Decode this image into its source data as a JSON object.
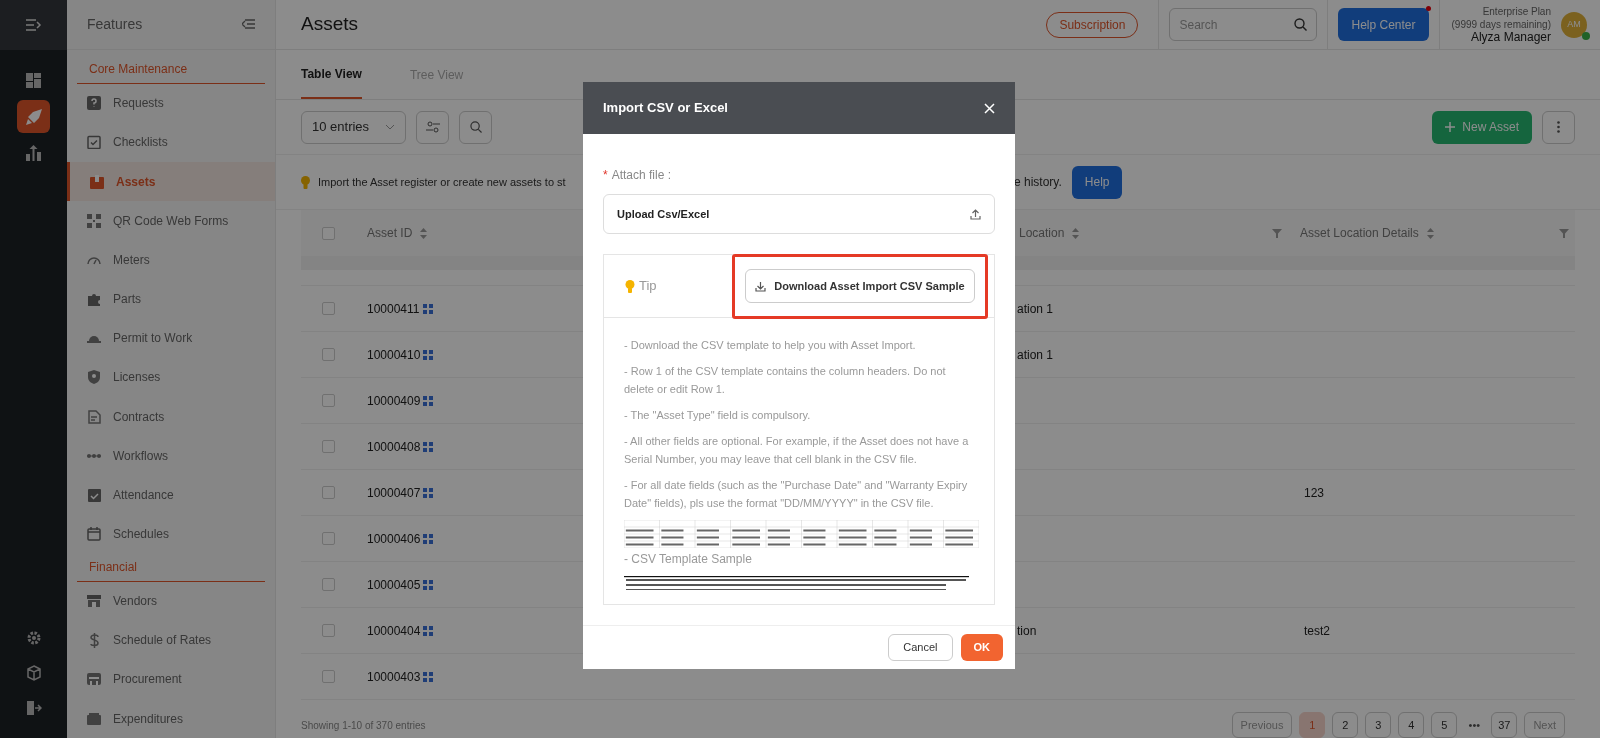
{
  "sidebar": {
    "title": "Features",
    "sections": [
      {
        "heading": "Core Maintenance",
        "items": [
          {
            "label": "Requests",
            "selected": false
          },
          {
            "label": "Checklists",
            "selected": false
          },
          {
            "label": "Assets",
            "selected": true
          },
          {
            "label": "QR Code Web Forms",
            "selected": false
          },
          {
            "label": "Meters",
            "selected": false
          },
          {
            "label": "Parts",
            "selected": false
          },
          {
            "label": "Permit to Work",
            "selected": false
          },
          {
            "label": "Licenses",
            "selected": false
          },
          {
            "label": "Contracts",
            "selected": false
          },
          {
            "label": "Workflows",
            "selected": false
          },
          {
            "label": "Attendance",
            "selected": false
          },
          {
            "label": "Schedules",
            "selected": false
          }
        ]
      },
      {
        "heading": "Financial",
        "items": [
          {
            "label": "Vendors",
            "selected": false
          },
          {
            "label": "Schedule of Rates",
            "selected": false
          },
          {
            "label": "Procurement",
            "selected": false
          },
          {
            "label": "Expenditures",
            "selected": false
          }
        ]
      }
    ]
  },
  "header": {
    "title": "Assets",
    "subscription": "Subscription",
    "search_placeholder": "Search",
    "help_center": "Help Center",
    "plan": "Enterprise Plan",
    "days": "(9999 days remaining)",
    "user": "Alyza Manager",
    "avatar": "AM"
  },
  "tabs": [
    {
      "label": "Table View",
      "selected": true
    },
    {
      "label": "Tree View",
      "selected": false
    }
  ],
  "toolbar": {
    "entries": "10 entries",
    "new_asset": "New Asset"
  },
  "info": {
    "text_start": "Import the Asset register or create new assets to st",
    "text_end": "e history.",
    "help": "Help"
  },
  "table": {
    "select_all": {
      "checked": false
    },
    "columns": [
      "Asset ID",
      "Location",
      "Asset Location Details"
    ],
    "rows": [
      {
        "checked": false,
        "asset_id": "10000411",
        "location": "ation 1",
        "details": ""
      },
      {
        "checked": false,
        "asset_id": "10000410",
        "location": "ation 1",
        "details": ""
      },
      {
        "checked": false,
        "asset_id": "10000409",
        "location": "",
        "details": ""
      },
      {
        "checked": false,
        "asset_id": "10000408",
        "location": "",
        "details": ""
      },
      {
        "checked": false,
        "asset_id": "10000407",
        "location": "",
        "details": "123"
      },
      {
        "checked": false,
        "asset_id": "10000406",
        "location": "",
        "details": ""
      },
      {
        "checked": false,
        "asset_id": "10000405",
        "location": "",
        "details": ""
      },
      {
        "checked": false,
        "asset_id": "10000404",
        "location": "tion",
        "details": "test2"
      },
      {
        "checked": false,
        "asset_id": "10000403",
        "location": "",
        "details": ""
      }
    ]
  },
  "footer": {
    "showing": "Showing 1-10 of 370 entries",
    "pages": [
      {
        "label": "Previous",
        "kind": "nav",
        "selected": false
      },
      {
        "label": "1",
        "kind": "page",
        "selected": true
      },
      {
        "label": "2",
        "kind": "page",
        "selected": false
      },
      {
        "label": "3",
        "kind": "page",
        "selected": false
      },
      {
        "label": "4",
        "kind": "page",
        "selected": false
      },
      {
        "label": "5",
        "kind": "page",
        "selected": false
      },
      {
        "label": "•••",
        "kind": "gap",
        "selected": false
      },
      {
        "label": "37",
        "kind": "page",
        "selected": false
      },
      {
        "label": "Next",
        "kind": "nav",
        "selected": false
      }
    ]
  },
  "dialog": {
    "title": "Import CSV or Excel",
    "required_mark": "*",
    "field_label": "Attach file :",
    "upload": "Upload Csv/Excel",
    "tip": "Tip",
    "download": "Download Asset Import CSV Sample",
    "notes": [
      "- Download the CSV template to help you with Asset Import.",
      "- Row 1 of the CSV template contains the column headers. Do not delete or edit Row 1.",
      "- The \"Asset Type\" field is compulsory.",
      "- All other fields are optional. For example, if the Asset does not have a Serial Number, you may leave that cell blank in the CSV file.",
      "- For all date fields (such as the \"Purchase Date\" and \"Warranty Expiry Date\" fields), pls use the format \"DD/MM/YYYY\" in the CSV file."
    ],
    "sample_caption": "- CSV Template Sample",
    "cancel": "Cancel",
    "ok": "OK"
  }
}
